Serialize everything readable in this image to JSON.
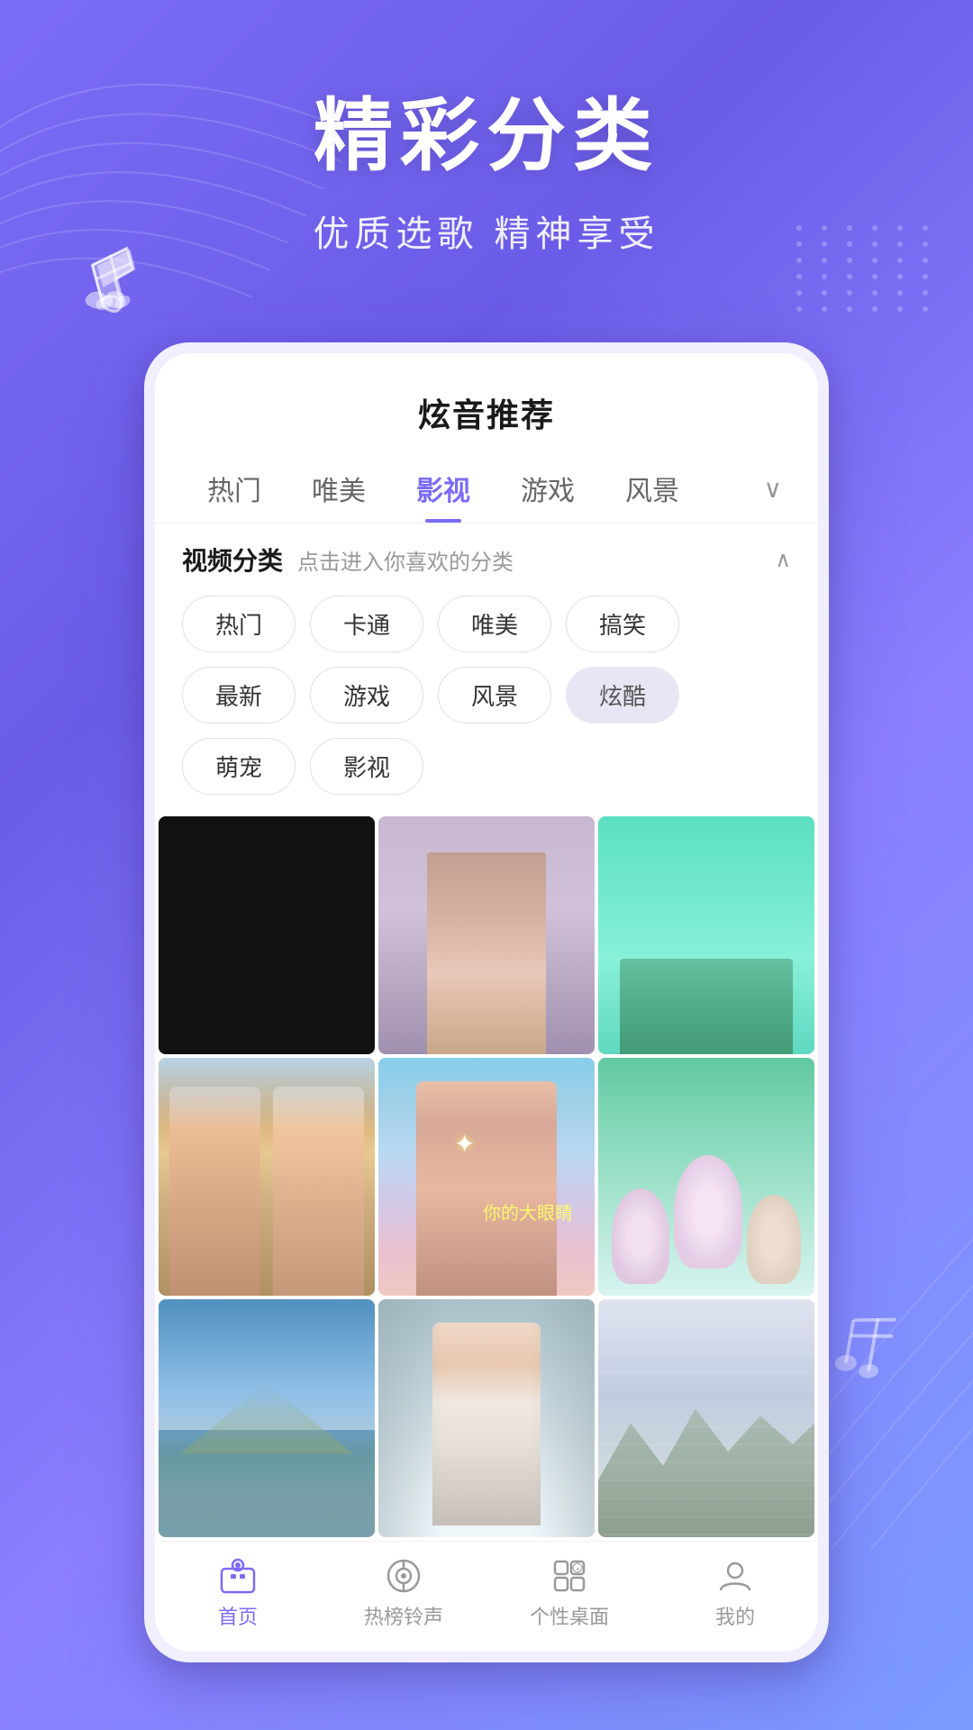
{
  "page": {
    "title": "精彩分类",
    "subtitle": "优质选歌 精神享受"
  },
  "app": {
    "header_title": "炫音推荐"
  },
  "tabs": [
    {
      "id": "hot",
      "label": "热门",
      "active": false
    },
    {
      "id": "beauty",
      "label": "唯美",
      "active": false
    },
    {
      "id": "film",
      "label": "影视",
      "active": true
    },
    {
      "id": "game",
      "label": "游戏",
      "active": false
    },
    {
      "id": "scenery",
      "label": "风景",
      "active": false
    }
  ],
  "category": {
    "label": "视频分类",
    "desc": "点击进入你喜欢的分类",
    "tags": [
      {
        "id": "hot",
        "label": "热门",
        "selected": false
      },
      {
        "id": "cartoon",
        "label": "卡通",
        "selected": false
      },
      {
        "id": "beauty",
        "label": "唯美",
        "selected": false
      },
      {
        "id": "funny",
        "label": "搞笑",
        "selected": false
      },
      {
        "id": "new",
        "label": "最新",
        "selected": false
      },
      {
        "id": "game",
        "label": "游戏",
        "selected": false
      },
      {
        "id": "scenery",
        "label": "风景",
        "selected": false
      },
      {
        "id": "cool",
        "label": "炫酷",
        "selected": true
      },
      {
        "id": "pet",
        "label": "萌宠",
        "selected": false
      },
      {
        "id": "film",
        "label": "影视",
        "selected": false
      }
    ]
  },
  "bottom_nav": [
    {
      "id": "home",
      "label": "首页",
      "active": true,
      "icon": "▶"
    },
    {
      "id": "ringtone",
      "label": "热榜铃声",
      "active": false,
      "icon": "♪"
    },
    {
      "id": "desktop",
      "label": "个性桌面",
      "active": false,
      "icon": "⊞"
    },
    {
      "id": "mine",
      "label": "我的",
      "active": false,
      "icon": "☺"
    }
  ],
  "thumbnails": [
    {
      "id": "t1",
      "type": "dark",
      "text": ""
    },
    {
      "id": "t2",
      "type": "gradient-gray",
      "text": ""
    },
    {
      "id": "t3",
      "type": "nature-teal",
      "text": ""
    },
    {
      "id": "t4",
      "type": "people-gold",
      "text": ""
    },
    {
      "id": "t5",
      "type": "people-blue",
      "text": "你的大眼睛"
    },
    {
      "id": "t6",
      "type": "nature-lotus",
      "text": ""
    },
    {
      "id": "t7",
      "type": "mountain-lake",
      "text": ""
    },
    {
      "id": "t8",
      "type": "indoor-person",
      "text": ""
    },
    {
      "id": "t9",
      "type": "clouds-mountain",
      "text": ""
    }
  ]
}
